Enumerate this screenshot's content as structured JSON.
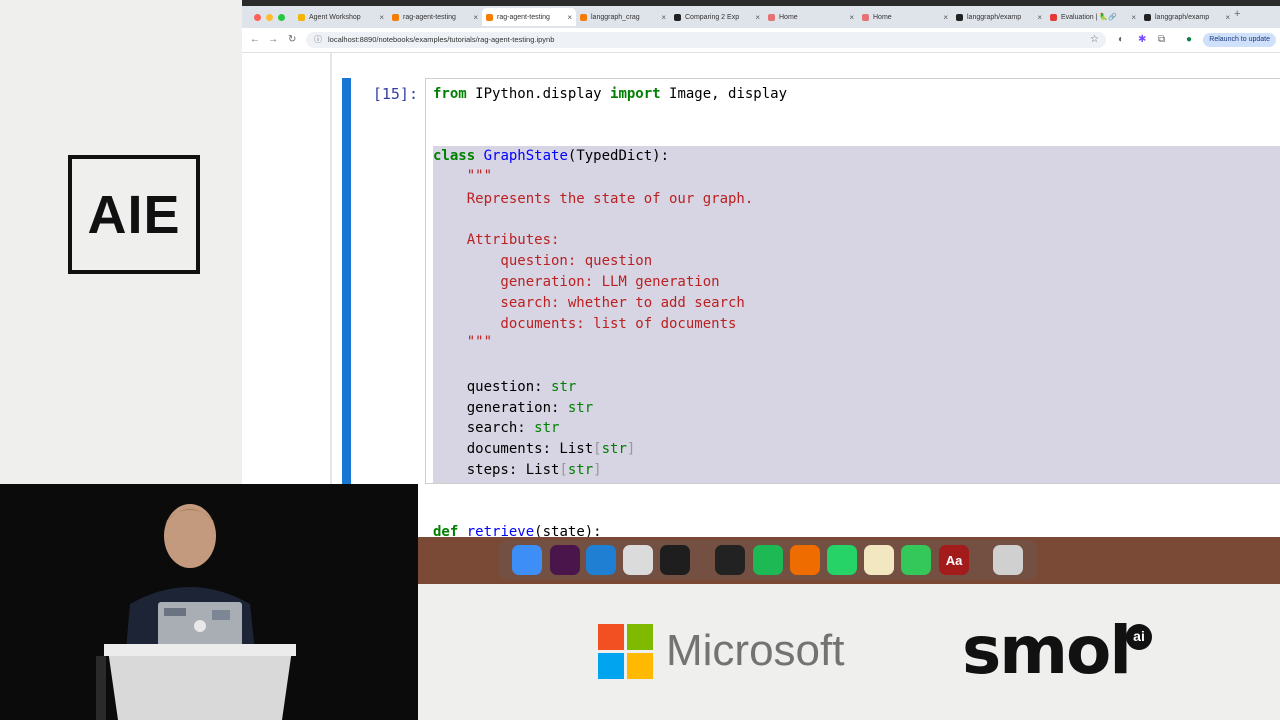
{
  "browser": {
    "tabs": [
      {
        "label": "Agent Workshop",
        "color": "#f4b400"
      },
      {
        "label": "rag-agent-testing",
        "color": "#f57c00"
      },
      {
        "label": "rag-agent-testing",
        "color": "#f57c00",
        "active": true
      },
      {
        "label": "langgraph_crag",
        "color": "#f57c00"
      },
      {
        "label": "Comparing 2 Exp",
        "color": "#222222"
      },
      {
        "label": "Home",
        "color": "#e57373"
      },
      {
        "label": "Home",
        "color": "#e57373"
      },
      {
        "label": "langgraph/examp",
        "color": "#222222"
      },
      {
        "label": "Evaluation | 🦜🔗",
        "color": "#e53935"
      },
      {
        "label": "langgraph/examp",
        "color": "#222222"
      }
    ],
    "url": "localhost:8890/notebooks/examples/tutorials/rag-agent-testing.ipynb",
    "relaunch_label": "Relaunch to update"
  },
  "branding": {
    "aie_logo": "AIE",
    "sponsor_microsoft": "Microsoft",
    "sponsor_smol": "smol",
    "sponsor_smol_badge": "ai"
  },
  "notebook": {
    "cell_prompt": "[15]:",
    "code_lines": [
      "from IPython.display import Image, display",
      "",
      "",
      "class GraphState(TypedDict):",
      "    \"\"\"",
      "    Represents the state of our graph.",
      "",
      "    Attributes:",
      "        question: question",
      "        generation: LLM generation",
      "        search: whether to add search",
      "        documents: list of documents",
      "    \"\"\"",
      "",
      "    question: str",
      "    generation: str",
      "    search: str",
      "    documents: List[str]",
      "    steps: List[str]",
      "",
      "",
      "def retrieve(state):"
    ]
  },
  "dock": {
    "apps": [
      "finder-icon",
      "slack-icon",
      "vscode-icon",
      "chrome-icon",
      "terminal-icon",
      "cursor-icon",
      "spotify-icon",
      "sublime-icon",
      "whatsapp-icon",
      "notes-icon",
      "messages-icon",
      "dictionary-icon",
      "trash-icon"
    ],
    "dictionary_label": "Aa"
  }
}
